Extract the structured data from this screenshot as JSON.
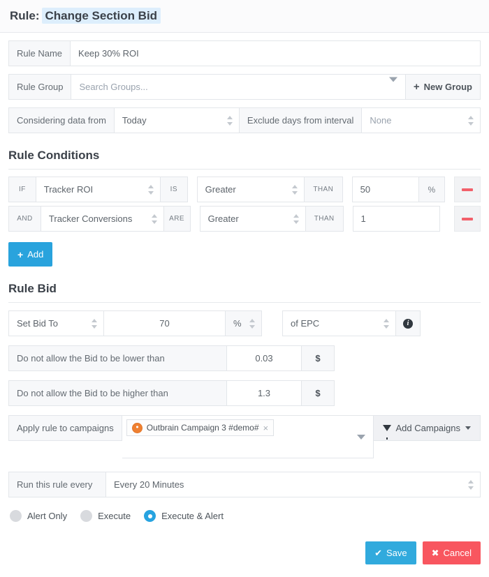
{
  "header": {
    "prefix": "Rule:",
    "rule_name": "Change Section Bid"
  },
  "rule_name_row": {
    "label": "Rule Name",
    "value": "Keep 30% ROI"
  },
  "rule_group_row": {
    "label": "Rule Group",
    "placeholder": "Search Groups...",
    "new_group_label": "New Group",
    "plus": "+"
  },
  "interval_row": {
    "considering_label": "Considering data from",
    "considering_value": "Today",
    "exclude_label": "Exclude days from interval",
    "exclude_value": "None"
  },
  "conditions": {
    "heading": "Rule Conditions",
    "add_label": "Add",
    "add_plus": "+",
    "rows": [
      {
        "prefix": "IF",
        "metric": "Tracker ROI",
        "verb": "IS",
        "operator": "Greater",
        "than": "THAN",
        "value": "50",
        "unit": "%"
      },
      {
        "prefix": "AND",
        "metric": "Tracker Conversions",
        "verb": "ARE",
        "operator": "Greater",
        "than": "THAN",
        "value": "1",
        "unit": ""
      }
    ]
  },
  "bid": {
    "heading": "Rule Bid",
    "action": "Set Bid To",
    "amount": "70",
    "unit": "%",
    "basis": "of EPC",
    "info_glyph": "i",
    "lower": {
      "label": "Do not allow the Bid to be lower than",
      "value": "0.03",
      "currency": "$"
    },
    "higher": {
      "label": "Do not allow the Bid to be higher than",
      "value": "1.3",
      "currency": "$"
    }
  },
  "campaigns": {
    "label": "Apply rule to campaigns",
    "chip": {
      "name": "Outbrain Campaign 3 #demo#",
      "remove_glyph": "×"
    },
    "add_button": "Add Campaigns"
  },
  "schedule": {
    "label": "Run this rule every",
    "value": "Every 20 Minutes"
  },
  "modes": [
    {
      "label": "Alert Only",
      "selected": false
    },
    {
      "label": "Execute",
      "selected": false
    },
    {
      "label": "Execute & Alert",
      "selected": true
    }
  ],
  "footer": {
    "save_label": "Save",
    "save_glyph": "✔",
    "cancel_label": "Cancel",
    "cancel_glyph": "✖"
  },
  "colors": {
    "accent": "#29a3dd",
    "danger": "#f8565f",
    "highlight": "#ddeefc",
    "outbrain": "#ef8031"
  }
}
